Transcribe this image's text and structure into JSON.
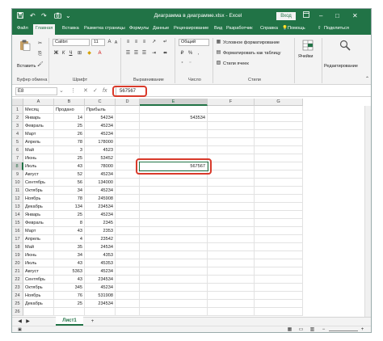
{
  "window": {
    "title": "Диаграмма в диаграмме.xlsx - Excel",
    "login_label": "Вход",
    "accent": "#217346",
    "highlight": "#d93a2b"
  },
  "ribbon_tabs": [
    "Файл",
    "Главная",
    "Вставка",
    "Разметка страницы",
    "Формулы",
    "Данные",
    "Рецензирование",
    "Вид",
    "Разработчик",
    "Справка"
  ],
  "ribbon_help": {
    "lightbulb_label": "Помощь",
    "share_label": "Поделиться"
  },
  "ribbon": {
    "paste_label": "Вставить",
    "clipboard_group": "Буфер обмена",
    "font_name": "Calibri",
    "font_size": "11",
    "font_group": "Шрифт",
    "alignment_group": "Выравнивание",
    "number_format": "Общий",
    "number_group": "Число",
    "conditional_formatting": "Условное форматирование",
    "format_as_table": "Форматировать как таблицу",
    "cell_styles": "Стили ячеек",
    "styles_group": "Стили",
    "cells_label": "Ячейки",
    "editing_label": "Редактирование"
  },
  "formula_bar": {
    "name_box": "E8",
    "fx": "fx",
    "formula": "567567"
  },
  "columns": [
    "A",
    "B",
    "C",
    "D",
    "E",
    "F",
    "G"
  ],
  "rows": [
    [
      "Месяц",
      "Продано",
      "Прибыль",
      "",
      ""
    ],
    [
      "Январь",
      "14",
      "54234",
      "",
      "543534"
    ],
    [
      "Февраль",
      "25",
      "45234",
      "",
      ""
    ],
    [
      "Март",
      "26",
      "45234",
      "",
      ""
    ],
    [
      "Апрель",
      "78",
      "178000",
      "",
      ""
    ],
    [
      "Май",
      "3",
      "4523",
      "",
      ""
    ],
    [
      "Июнь",
      "25",
      "53452",
      "",
      ""
    ],
    [
      "Июль",
      "43",
      "78000",
      "",
      "567567"
    ],
    [
      "Август",
      "52",
      "45234",
      "",
      ""
    ],
    [
      "Сентябрь",
      "56",
      "134000",
      "",
      ""
    ],
    [
      "Октябрь",
      "34",
      "45234",
      "",
      ""
    ],
    [
      "Ноябрь",
      "78",
      "245908",
      "",
      ""
    ],
    [
      "Декабрь",
      "134",
      "234534",
      "",
      ""
    ],
    [
      "Январь",
      "25",
      "45234",
      "",
      ""
    ],
    [
      "Февраль",
      "8",
      "2345",
      "",
      ""
    ],
    [
      "Март",
      "43",
      "2353",
      "",
      ""
    ],
    [
      "Апрель",
      "4",
      "23542",
      "",
      ""
    ],
    [
      "Май",
      "35",
      "24534",
      "",
      ""
    ],
    [
      "Июнь",
      "34",
      "4353",
      "",
      ""
    ],
    [
      "Июль",
      "43",
      "45353",
      "",
      ""
    ],
    [
      "Август",
      "5363",
      "45234",
      "",
      ""
    ],
    [
      "Сентябрь",
      "43",
      "234534",
      "",
      ""
    ],
    [
      "Октябрь",
      "345",
      "45234",
      "",
      ""
    ],
    [
      "Ноябрь",
      "76",
      "531908",
      "",
      ""
    ],
    [
      "Декабрь",
      "25",
      "234534",
      "",
      ""
    ]
  ],
  "sheet": {
    "tab_name": "Лист1",
    "add_sheet": "+"
  }
}
